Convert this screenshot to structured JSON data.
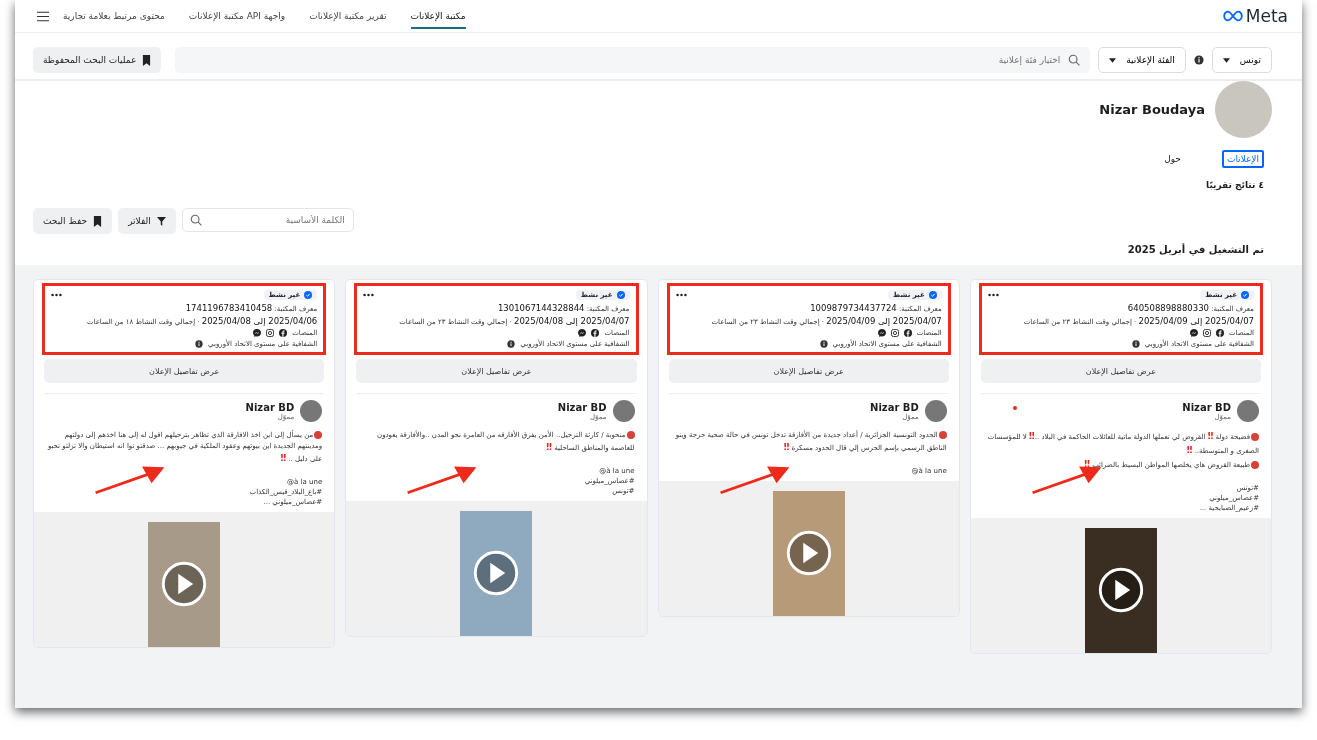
{
  "header": {
    "logo": "Meta",
    "nav": [
      {
        "label": "مكتبة الإعلانات",
        "selected": true
      },
      {
        "label": "تقرير مكتبة الإعلانات",
        "selected": false
      },
      {
        "label": "واجهة API مكتبة الإعلانات",
        "selected": false
      },
      {
        "label": "محتوى مرتبط بعلامة تجارية",
        "selected": false
      }
    ]
  },
  "search_bar": {
    "country": "تونس",
    "category": "الفئة الإعلانية",
    "placeholder": "اختيار فئة إعلانية",
    "saved_searches": "عمليات البحث المحفوظة"
  },
  "profile": {
    "name": "Nizar Boudaya",
    "tabs": [
      {
        "label": "الإعلانات",
        "selected": true
      },
      {
        "label": "حول",
        "selected": false
      }
    ],
    "results": "٤ نتائج تقريبًا",
    "keyword_placeholder": "الكلمة الأساسية",
    "filters": "الفلاتر",
    "save_search": "حفظ البحث",
    "section_title": "تم التشغيل في أبريل 2025"
  },
  "cards": [
    {
      "status": "غير نشط",
      "id_label": "معرف المكتبة:",
      "library_id": "640508898880330",
      "dates": "2025/04/07 إلى 2025/04/09",
      "duration": "· إجمالي وقت النشاط ٢٣ من الساعات",
      "platforms_label": "المنصات",
      "platforms": [
        {
          "kind": "facebook"
        },
        {
          "kind": "instagram"
        },
        {
          "kind": "messenger"
        }
      ],
      "transparency": "الشفافية على مستوى الاتحاد الأوروبي",
      "details": "عرض تفاصيل الإعلان",
      "advertiser": "Nizar BD",
      "sponsored": "مموّل",
      "paragraphs": [
        {
          "bullet": true,
          "segments": [
            {
              "kind": "text",
              "text": "فضيحة دولة "
            },
            {
              "kind": "alert",
              "text": "‼"
            },
            {
              "kind": "text",
              "text": " القروض لي تعملها الدولة ماتية للعائلات الحاكمة في البلاد .."
            },
            {
              "kind": "alert",
              "text": "‼"
            },
            {
              "kind": "text",
              "text": " لا للمؤسسات الصغرى و المتوسطة.. "
            },
            {
              "kind": "alert",
              "text": "‼"
            }
          ]
        },
        {
          "bullet": true,
          "segments": [
            {
              "kind": "text",
              "text": "طبيعة القروض هاي يخلصها المواطن البسيط بالضرائب "
            },
            {
              "kind": "alert",
              "text": "‼"
            }
          ]
        }
      ],
      "tags": [
        "#تونس",
        "#عصاس_ميلوني",
        "#زعيم_الصبايحية ..."
      ]
    },
    {
      "status": "غير نشط",
      "id_label": "معرف المكتبة:",
      "library_id": "1009879734437724",
      "dates": "2025/04/07 إلى 2025/04/09",
      "duration": "· إجمالي وقت النشاط ٢٣ من الساعات",
      "platforms_label": "المنصات",
      "platforms": [
        {
          "kind": "facebook"
        },
        {
          "kind": "instagram"
        },
        {
          "kind": "messenger"
        }
      ],
      "transparency": "الشفافية على مستوى الاتحاد الأوروبي",
      "details": "عرض تفاصيل الإعلان",
      "advertiser": "Nizar BD",
      "sponsored": "مموّل",
      "paragraphs": [
        {
          "bullet": true,
          "segments": [
            {
              "kind": "text",
              "text": "الحدود التونسية الجزائرية / أعداد جديدة من الأفارقة تدخل تونس في حالة صحية حرجة وينو الناطق الرسمي بإسم الحرس إلي قال الحدود مسكرة "
            },
            {
              "kind": "alert",
              "text": "‼"
            }
          ]
        }
      ],
      "tags": [
        "à la une@"
      ]
    },
    {
      "status": "غير نشط",
      "id_label": "معرف المكتبة:",
      "library_id": "1301067144328844",
      "dates": "2025/04/07 إلى 2025/04/08",
      "duration": "· إجمالي وقت النشاط ٢٣ من الساعات",
      "platforms_label": "المنصات",
      "platforms": [
        {
          "kind": "facebook"
        },
        {
          "kind": "messenger"
        }
      ],
      "transparency": "الشفافية على مستوى الاتحاد الأوروبي",
      "details": "عرض تفاصيل الإعلان",
      "advertiser": "Nizar BD",
      "sponsored": "مموّل",
      "paragraphs": [
        {
          "bullet": true,
          "segments": [
            {
              "kind": "text",
              "text": "منحوبة / كارثة الترحيل.. الأمن يفرق الأفارقه من العامرة نحو المدن ..والأفارقة يعودون للعاصمة والمناطق الساحلية "
            },
            {
              "kind": "alert",
              "text": "‼"
            }
          ]
        }
      ],
      "tags": [
        "à la une@",
        "#عصاس_ميلوني",
        "#تونس"
      ]
    },
    {
      "status": "غير نشط",
      "id_label": "معرف المكتبة:",
      "library_id": "1741196783410458",
      "dates": "2025/04/06 إلى 2025/04/08",
      "duration": "· إجمالي وقت النشاط ١٨ من الساعات",
      "platforms_label": "المنصات",
      "platforms": [
        {
          "kind": "facebook"
        },
        {
          "kind": "instagram"
        },
        {
          "kind": "messenger"
        }
      ],
      "transparency": "الشفافية على مستوى الاتحاد الأوروبي",
      "details": "عرض تفاصيل الإعلان",
      "advertiser": "Nizar BD",
      "sponsored": "مموّل",
      "paragraphs": [
        {
          "bullet": true,
          "segments": [
            {
              "kind": "text",
              "text": "من يسأل إلى اين اخذ الافارقة الذي تظاهر بترحيلهم اقول له إلى هنا اخذهم إلى دولتهم ومدينتهم الجديدة اين بيوتهم وعقود الملكية في جيوبهم ... صدقتو توا انه استيطان والا تزلتو تحبو على دليل .. "
            },
            {
              "kind": "alert",
              "text": "‼"
            }
          ]
        }
      ],
      "tags": [
        "à la une@",
        "#باع_البلاد_قيس_الكذاب",
        "#عصاس_ميلوني ..."
      ]
    }
  ]
}
